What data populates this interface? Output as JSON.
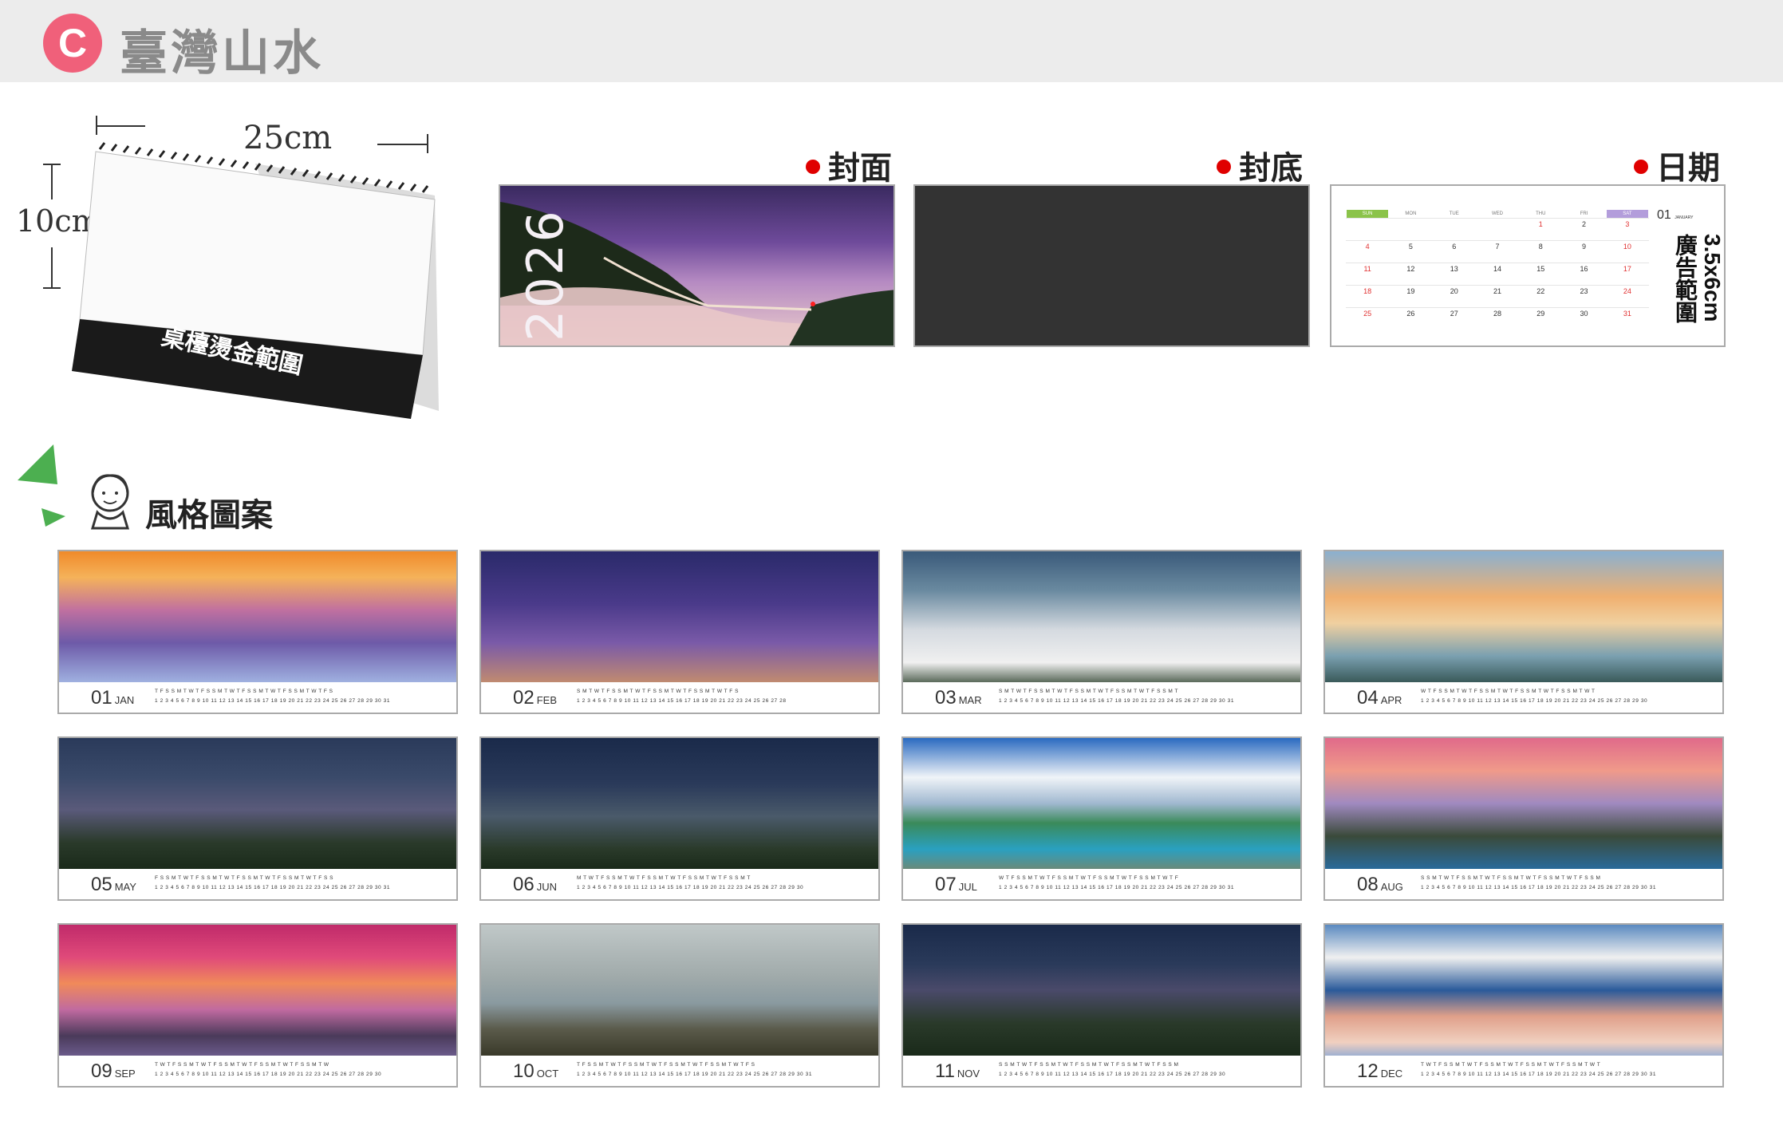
{
  "header": {
    "badge": "C",
    "title": "臺灣山水"
  },
  "product": {
    "width_label": "25cm",
    "height_label": "10cm",
    "imprint_label": "桌檯燙金範圍"
  },
  "sections": {
    "cover": "封面",
    "back": "封底",
    "dates": "日期",
    "styles": "風格圖案"
  },
  "cover": {
    "year": "2026"
  },
  "date_sample": {
    "month_label": "01",
    "month_sub": "JANUARY",
    "ad_range": "3.5x6cm 廣告範圍",
    "weekdays": [
      "SUN",
      "MON",
      "TUE",
      "WED",
      "THU",
      "FRI",
      "SAT"
    ],
    "rows": [
      [
        "",
        "",
        "",
        "",
        "1",
        "2",
        "3"
      ],
      [
        "4",
        "5",
        "6",
        "7",
        "8",
        "9",
        "10"
      ],
      [
        "11",
        "12",
        "13",
        "14",
        "15",
        "16",
        "17"
      ],
      [
        "18",
        "19",
        "20",
        "21",
        "22",
        "23",
        "24"
      ],
      [
        "25",
        "26",
        "27",
        "28",
        "29",
        "30",
        "31"
      ]
    ]
  },
  "months": [
    {
      "num": "01",
      "name": "JAN"
    },
    {
      "num": "02",
      "name": "FEB"
    },
    {
      "num": "03",
      "name": "MAR"
    },
    {
      "num": "04",
      "name": "APR"
    },
    {
      "num": "05",
      "name": "MAY"
    },
    {
      "num": "06",
      "name": "JUN"
    },
    {
      "num": "07",
      "name": "JUL"
    },
    {
      "num": "08",
      "name": "AUG"
    },
    {
      "num": "09",
      "name": "SEP"
    },
    {
      "num": "10",
      "name": "OCT"
    },
    {
      "num": "11",
      "name": "NOV"
    },
    {
      "num": "12",
      "name": "DEC"
    }
  ],
  "colors": {
    "badge": "#f0607a",
    "dot": "#e00000",
    "header_bg": "#ececec",
    "back_cover": "#333333"
  }
}
